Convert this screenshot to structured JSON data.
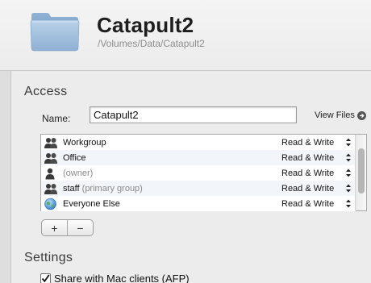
{
  "share": {
    "name": "Catapult2",
    "path": "/Volumes/Data/Catapult2"
  },
  "access": {
    "section_title": "Access",
    "name_label": "Name:",
    "name_value": "Catapult2",
    "view_files_label": "View Files",
    "entries": [
      {
        "name": "Workgroup",
        "note": "",
        "icon": "group-icon",
        "permission": "Read & Write"
      },
      {
        "name": "Office",
        "note": "",
        "icon": "group-icon",
        "permission": "Read & Write"
      },
      {
        "name": "",
        "note": "(owner)",
        "icon": "user-icon",
        "permission": "Read & Write"
      },
      {
        "name": "staff",
        "note": "(primary group)",
        "icon": "group-icon",
        "permission": "Read & Write"
      },
      {
        "name": "Everyone Else",
        "note": "",
        "icon": "globe-icon",
        "permission": "Read & Write"
      }
    ],
    "add_label": "+",
    "remove_label": "−"
  },
  "settings": {
    "section_title": "Settings",
    "afp_label": "Share with Mac clients (AFP)",
    "afp_checked": true
  }
}
